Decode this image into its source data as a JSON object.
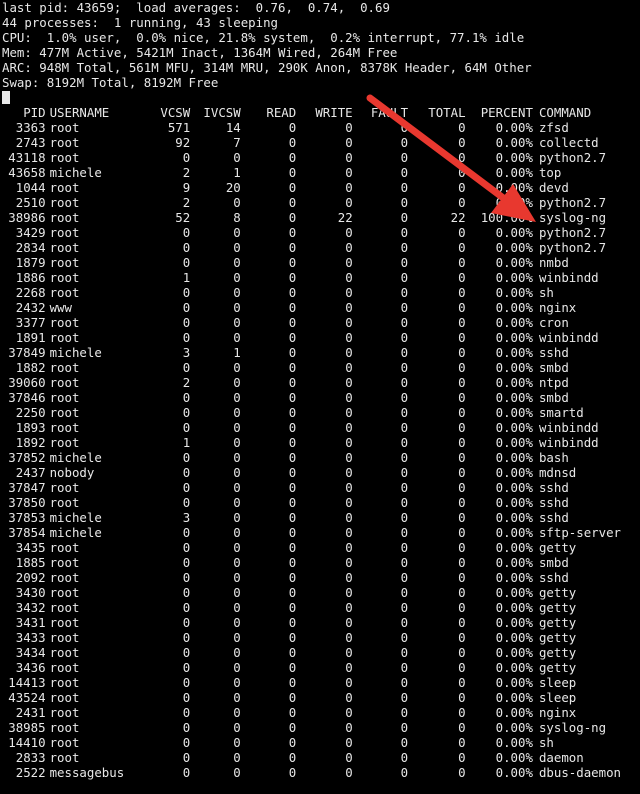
{
  "header": {
    "line1": "last pid: 43659;  load averages:  0.76,  0.74,  0.69",
    "line2": "44 processes:  1 running, 43 sleeping",
    "line3": "CPU:  1.0% user,  0.0% nice, 21.8% system,  0.2% interrupt, 77.1% idle",
    "line4": "Mem: 477M Active, 5421M Inact, 1364M Wired, 264M Free",
    "line5": "ARC: 948M Total, 561M MFU, 314M MRU, 290K Anon, 8378K Header, 64M Other",
    "line6": "Swap: 8192M Total, 8192M Free"
  },
  "columns": {
    "pid": "PID",
    "user": "USERNAME",
    "vcsw": "VCSW",
    "ivcsw": "IVCSW",
    "read": "READ",
    "write": "WRITE",
    "fault": "FAULT",
    "total": "TOTAL",
    "percent": "PERCENT",
    "command": "COMMAND"
  },
  "processes": [
    [
      "3363",
      "root",
      "571",
      "14",
      "0",
      "0",
      "0",
      "0",
      "0.00%",
      "zfsd"
    ],
    [
      "2743",
      "root",
      "92",
      "7",
      "0",
      "0",
      "0",
      "0",
      "0.00%",
      "collectd"
    ],
    [
      "43118",
      "root",
      "0",
      "0",
      "0",
      "0",
      "0",
      "0",
      "0.00%",
      "python2.7"
    ],
    [
      "43658",
      "michele",
      "2",
      "1",
      "0",
      "0",
      "0",
      "0",
      "0.00%",
      "top"
    ],
    [
      "1044",
      "root",
      "9",
      "20",
      "0",
      "0",
      "0",
      "0",
      "0.00%",
      "devd"
    ],
    [
      "2510",
      "root",
      "2",
      "0",
      "0",
      "0",
      "0",
      "0",
      "0.00%",
      "python2.7"
    ],
    [
      "38986",
      "root",
      "52",
      "8",
      "0",
      "22",
      "0",
      "22",
      "100.00%",
      "syslog-ng"
    ],
    [
      "3429",
      "root",
      "0",
      "0",
      "0",
      "0",
      "0",
      "0",
      "0.00%",
      "python2.7"
    ],
    [
      "2834",
      "root",
      "0",
      "0",
      "0",
      "0",
      "0",
      "0",
      "0.00%",
      "python2.7"
    ],
    [
      "1879",
      "root",
      "0",
      "0",
      "0",
      "0",
      "0",
      "0",
      "0.00%",
      "nmbd"
    ],
    [
      "1886",
      "root",
      "1",
      "0",
      "0",
      "0",
      "0",
      "0",
      "0.00%",
      "winbindd"
    ],
    [
      "2268",
      "root",
      "0",
      "0",
      "0",
      "0",
      "0",
      "0",
      "0.00%",
      "sh"
    ],
    [
      "2432",
      "www",
      "0",
      "0",
      "0",
      "0",
      "0",
      "0",
      "0.00%",
      "nginx"
    ],
    [
      "3377",
      "root",
      "0",
      "0",
      "0",
      "0",
      "0",
      "0",
      "0.00%",
      "cron"
    ],
    [
      "1891",
      "root",
      "0",
      "0",
      "0",
      "0",
      "0",
      "0",
      "0.00%",
      "winbindd"
    ],
    [
      "37849",
      "michele",
      "3",
      "1",
      "0",
      "0",
      "0",
      "0",
      "0.00%",
      "sshd"
    ],
    [
      "1882",
      "root",
      "0",
      "0",
      "0",
      "0",
      "0",
      "0",
      "0.00%",
      "smbd"
    ],
    [
      "39060",
      "root",
      "2",
      "0",
      "0",
      "0",
      "0",
      "0",
      "0.00%",
      "ntpd"
    ],
    [
      "37846",
      "root",
      "0",
      "0",
      "0",
      "0",
      "0",
      "0",
      "0.00%",
      "smbd"
    ],
    [
      "2250",
      "root",
      "0",
      "0",
      "0",
      "0",
      "0",
      "0",
      "0.00%",
      "smartd"
    ],
    [
      "1893",
      "root",
      "0",
      "0",
      "0",
      "0",
      "0",
      "0",
      "0.00%",
      "winbindd"
    ],
    [
      "1892",
      "root",
      "1",
      "0",
      "0",
      "0",
      "0",
      "0",
      "0.00%",
      "winbindd"
    ],
    [
      "37852",
      "michele",
      "0",
      "0",
      "0",
      "0",
      "0",
      "0",
      "0.00%",
      "bash"
    ],
    [
      "2437",
      "nobody",
      "0",
      "0",
      "0",
      "0",
      "0",
      "0",
      "0.00%",
      "mdnsd"
    ],
    [
      "37847",
      "root",
      "0",
      "0",
      "0",
      "0",
      "0",
      "0",
      "0.00%",
      "sshd"
    ],
    [
      "37850",
      "root",
      "0",
      "0",
      "0",
      "0",
      "0",
      "0",
      "0.00%",
      "sshd"
    ],
    [
      "37853",
      "michele",
      "3",
      "0",
      "0",
      "0",
      "0",
      "0",
      "0.00%",
      "sshd"
    ],
    [
      "37854",
      "michele",
      "0",
      "0",
      "0",
      "0",
      "0",
      "0",
      "0.00%",
      "sftp-server"
    ],
    [
      "3435",
      "root",
      "0",
      "0",
      "0",
      "0",
      "0",
      "0",
      "0.00%",
      "getty"
    ],
    [
      "1885",
      "root",
      "0",
      "0",
      "0",
      "0",
      "0",
      "0",
      "0.00%",
      "smbd"
    ],
    [
      "2092",
      "root",
      "0",
      "0",
      "0",
      "0",
      "0",
      "0",
      "0.00%",
      "sshd"
    ],
    [
      "3430",
      "root",
      "0",
      "0",
      "0",
      "0",
      "0",
      "0",
      "0.00%",
      "getty"
    ],
    [
      "3432",
      "root",
      "0",
      "0",
      "0",
      "0",
      "0",
      "0",
      "0.00%",
      "getty"
    ],
    [
      "3431",
      "root",
      "0",
      "0",
      "0",
      "0",
      "0",
      "0",
      "0.00%",
      "getty"
    ],
    [
      "3433",
      "root",
      "0",
      "0",
      "0",
      "0",
      "0",
      "0",
      "0.00%",
      "getty"
    ],
    [
      "3434",
      "root",
      "0",
      "0",
      "0",
      "0",
      "0",
      "0",
      "0.00%",
      "getty"
    ],
    [
      "3436",
      "root",
      "0",
      "0",
      "0",
      "0",
      "0",
      "0",
      "0.00%",
      "getty"
    ],
    [
      "14413",
      "root",
      "0",
      "0",
      "0",
      "0",
      "0",
      "0",
      "0.00%",
      "sleep"
    ],
    [
      "43524",
      "root",
      "0",
      "0",
      "0",
      "0",
      "0",
      "0",
      "0.00%",
      "sleep"
    ],
    [
      "2431",
      "root",
      "0",
      "0",
      "0",
      "0",
      "0",
      "0",
      "0.00%",
      "nginx"
    ],
    [
      "38985",
      "root",
      "0",
      "0",
      "0",
      "0",
      "0",
      "0",
      "0.00%",
      "syslog-ng"
    ],
    [
      "14410",
      "root",
      "0",
      "0",
      "0",
      "0",
      "0",
      "0",
      "0.00%",
      "sh"
    ],
    [
      "2833",
      "root",
      "0",
      "0",
      "0",
      "0",
      "0",
      "0",
      "0.00%",
      "daemon"
    ],
    [
      "2522",
      "messagebus",
      "0",
      "0",
      "0",
      "0",
      "0",
      "0",
      "0.00%",
      "dbus-daemon"
    ]
  ],
  "annotation": {
    "arrow_icon": "red-arrow-icon",
    "arrow_color": "#e8382f"
  },
  "colors": {
    "background": "#000000",
    "text": "#e8e8e8"
  }
}
